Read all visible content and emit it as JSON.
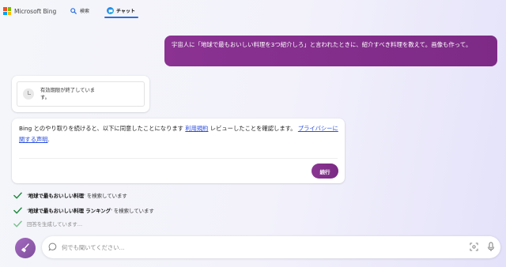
{
  "header": {
    "brand": "Microsoft Bing",
    "tabs": [
      {
        "label": "検索",
        "icon": "search-icon"
      },
      {
        "label": "チャット",
        "icon": "chat-icon",
        "active": true
      }
    ],
    "logo_colors": [
      "#f25022",
      "#7fba00",
      "#00a4ef",
      "#ffb900"
    ]
  },
  "user_message": {
    "text": "宇宙人に「地球で最もおいしい料理を3つ紹介しろ」と言われたときに、紹介すべき料理を教えて。画像も作って。"
  },
  "expire_card": {
    "text": "有効期限が終了しています。",
    "icon": "clock-icon"
  },
  "terms_card": {
    "text_before": "Bing とのやり取りを続けると、以下に同意したことになります ",
    "terms_link": "利用規約",
    "text_middle": " レビューしたことを確認します。 ",
    "privacy_link": "プライバシーに関する声明",
    "text_after": ".",
    "continue_button": "続行"
  },
  "progress": [
    {
      "query": "地球で最もおいしい料理",
      "suffix": " を検索しています",
      "done": true
    },
    {
      "query": "地球で最もおいしい料理 ランキング",
      "suffix": " を検索しています",
      "done": true
    },
    {
      "text": "回答を生成しています…",
      "done": false
    }
  ],
  "input": {
    "placeholder": "何でも聞いてください..."
  },
  "colors": {
    "accent": "#7d2a86",
    "link": "#2a4ee0",
    "check": "#1f8a3d"
  }
}
